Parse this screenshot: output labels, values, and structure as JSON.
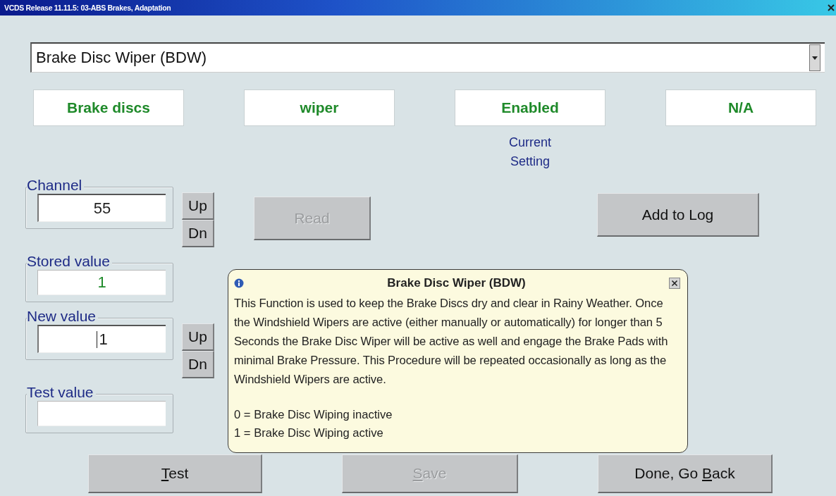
{
  "window": {
    "title": "VCDS Release 11.11.5: 03-ABS Brakes,  Adaptation"
  },
  "function_select": {
    "value": "Brake Disc Wiper (BDW)"
  },
  "setting_boxes": [
    {
      "text": "Brake discs"
    },
    {
      "text": "wiper"
    },
    {
      "text": "Enabled"
    },
    {
      "text": "N/A"
    }
  ],
  "setting_caption": "Current Setting",
  "fields": [
    {
      "label": "Channel",
      "value": "55",
      "kind": "input",
      "stepper": {
        "up": "Up",
        "down": "Dn"
      }
    },
    {
      "label": "Stored value",
      "value": "1",
      "kind": "readout"
    },
    {
      "label": "New value",
      "value": "1",
      "kind": "input",
      "stepper": {
        "up": "Up",
        "down": "Dn"
      }
    },
    {
      "label": "Test value",
      "kind": "readout"
    }
  ],
  "read_button": {
    "label": "Read",
    "disabled": true
  },
  "log_button": {
    "label": "Add to Log",
    "disabled": false
  },
  "bottom_buttons": [
    {
      "key": "T",
      "after": "est",
      "disabled": false
    },
    {
      "key": "S",
      "after": "ave",
      "disabled": true
    },
    {
      "before": "Done, Go ",
      "key": "B",
      "after": "ack",
      "disabled": false
    }
  ],
  "popup": {
    "title": "Brake Disc Wiper (BDW)",
    "body": "This Function is used to keep the Brake Discs dry and clear in Rainy Weather. Once the Windshield Wipers are active (either manually or automatically) for longer than 5 Seconds the Brake Disc Wiper will be active as well and engage the Brake Pads with minimal Brake Pressure. This Procedure will be repeated occasionally as long as the Windshield Wipers are active.",
    "legend": [
      "0 = Brake Disc Wiping inactive",
      "1 = Brake Disc Wiping active"
    ]
  }
}
